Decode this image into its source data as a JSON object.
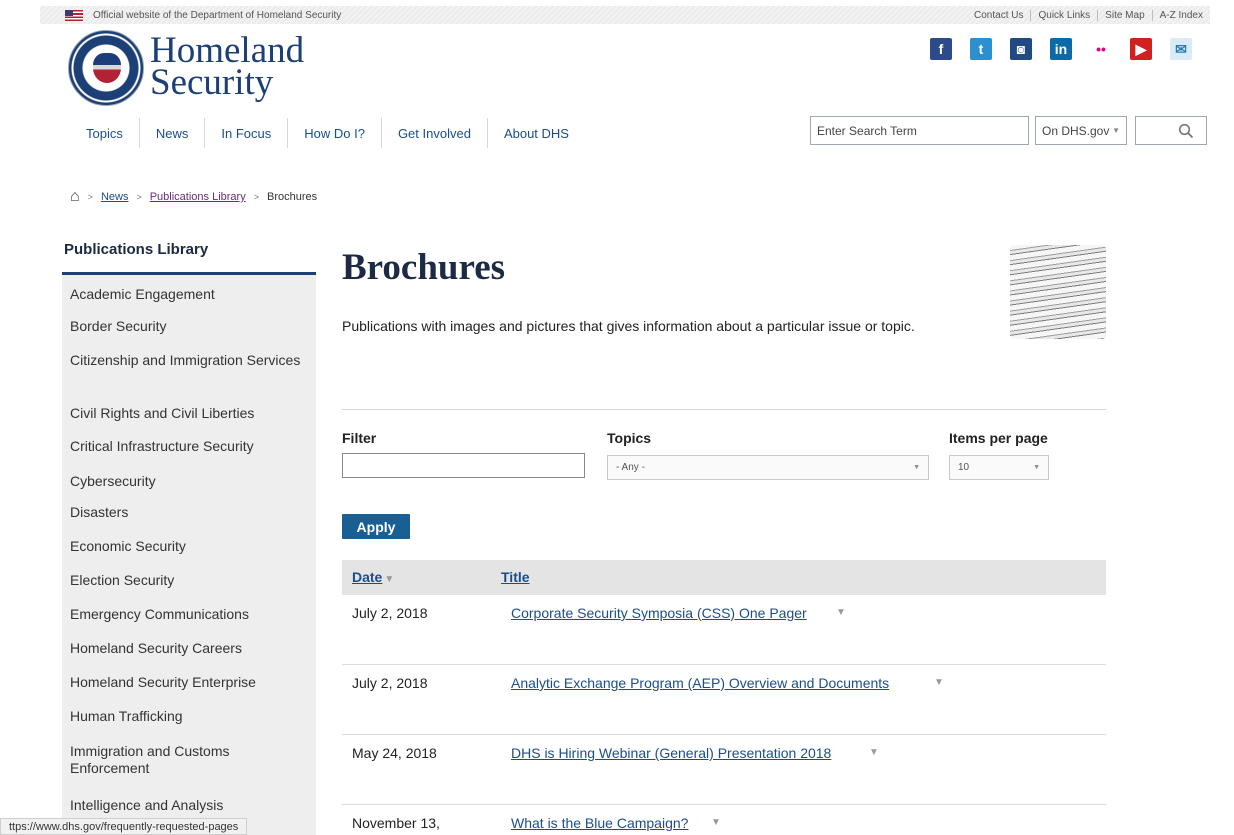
{
  "utility": {
    "official_text": "Official website of the Department of Homeland Security",
    "links": [
      "Contact Us",
      "Quick Links",
      "Site Map",
      "A-Z Index"
    ]
  },
  "header": {
    "logo_line1": "Homeland",
    "logo_line2": "Security",
    "social": [
      {
        "name": "facebook-icon",
        "glyph": "f"
      },
      {
        "name": "twitter-icon",
        "glyph": "t"
      },
      {
        "name": "instagram-icon",
        "glyph": "◙"
      },
      {
        "name": "linkedin-icon",
        "glyph": "in"
      },
      {
        "name": "flickr-icon",
        "glyph": "••"
      },
      {
        "name": "youtube-icon",
        "glyph": "▶"
      },
      {
        "name": "email-icon",
        "glyph": "✉"
      }
    ]
  },
  "nav": {
    "items": [
      "Topics",
      "News",
      "In Focus",
      "How Do I?",
      "Get Involved",
      "About DHS"
    ]
  },
  "search": {
    "placeholder": "Enter Search Term",
    "scope": "On DHS.gov"
  },
  "breadcrumb": {
    "items": [
      "News",
      "Publications Library"
    ],
    "current": "Brochures"
  },
  "sidebar": {
    "heading": "Publications Library",
    "items": [
      "Academic Engagement",
      "Border Security",
      "Citizenship and Immigration Services",
      "Civil Rights and Civil Liberties",
      "Critical Infrastructure Security",
      "Cybersecurity",
      "Disasters",
      "Economic Security",
      "Election Security",
      "Emergency Communications",
      "Homeland Security Careers",
      "Homeland Security Enterprise",
      "Human Trafficking",
      "Immigration and Customs Enforcement",
      "Intelligence and Analysis"
    ]
  },
  "main": {
    "title": "Brochures",
    "intro": "Publications with images and pictures that gives information about a particular issue or topic."
  },
  "filters": {
    "filter_label": "Filter",
    "filter_value": "",
    "topics_label": "Topics",
    "topics_value": "- Any -",
    "items_label": "Items per page",
    "items_value": "10",
    "apply_label": "Apply"
  },
  "table": {
    "col_date": "Date",
    "col_title": "Title",
    "rows": [
      {
        "date": "July 2, 2018",
        "title": "Corporate Security Symposia (CSS) One Pager"
      },
      {
        "date": "July 2, 2018",
        "title": "Analytic Exchange Program (AEP) Overview and Documents"
      },
      {
        "date": "May 24, 2018",
        "title": "DHS is Hiring Webinar (General) Presentation 2018"
      },
      {
        "date": "November 13,",
        "title": "What is the Blue Campaign?"
      }
    ]
  },
  "status": {
    "url": "ttps://www.dhs.gov/frequently-requested-pages"
  },
  "colors": {
    "brand_navy": "#1c3f76",
    "link_blue": "#1a4e8a",
    "apply_button": "#1a5f94"
  }
}
